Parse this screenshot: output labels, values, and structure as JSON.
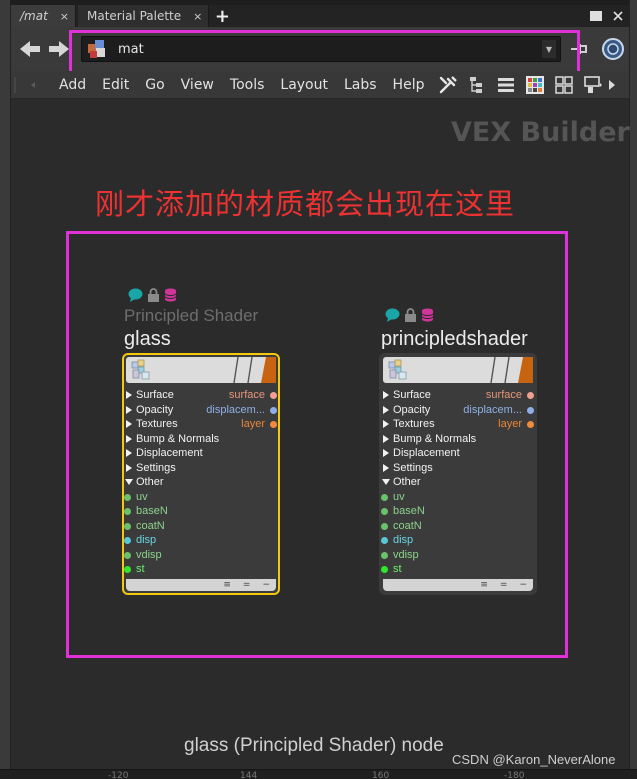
{
  "tabs": [
    {
      "label": "/mat",
      "close": "×",
      "active": true
    },
    {
      "label": "Material Palette",
      "close": "×",
      "active": false
    }
  ],
  "tab_add": "+",
  "path": {
    "value": "mat"
  },
  "menu": [
    "Add",
    "Edit",
    "Go",
    "View",
    "Tools",
    "Layout",
    "Labs",
    "Help"
  ],
  "toolbar_icons": [
    "wrench-icon",
    "tree-view-icon",
    "list-view-icon",
    "color-palette-icon",
    "thumbnail-grid-icon",
    "network-options-icon"
  ],
  "network": {
    "context_title": "VEX Builder",
    "annotation": "刚才添加的材质都会出现在这里",
    "caption": "glass (Principled Shader) node",
    "watermark": "CSDN @Karon_NeverAlone",
    "ruler": [
      "-120",
      "144",
      "160",
      "-180"
    ]
  },
  "nodes": [
    {
      "type_label": "Principled Shader",
      "name": "glass",
      "selected": true,
      "folders": [
        "Surface",
        "Opacity",
        "Textures",
        "Bump & Normals",
        "Displacement",
        "Settings"
      ],
      "open_folder": "Other",
      "inputs": [
        "uv",
        "baseN",
        "coatN",
        "disp",
        "vdisp",
        "st"
      ],
      "outputs": [
        "surface",
        "displacem...",
        "layer"
      ],
      "foot_icons": [
        "≡",
        "=",
        "−"
      ]
    },
    {
      "type_label": "",
      "name": "principledshader",
      "selected": false,
      "folders": [
        "Surface",
        "Opacity",
        "Textures",
        "Bump & Normals",
        "Displacement",
        "Settings"
      ],
      "open_folder": "Other",
      "inputs": [
        "uv",
        "baseN",
        "coatN",
        "disp",
        "vdisp",
        "st"
      ],
      "outputs": [
        "surface",
        "displacem...",
        "layer"
      ],
      "foot_icons": [
        "≡",
        "=",
        "−"
      ]
    }
  ],
  "colors": {
    "highlight": "#e030d8",
    "annotation": "#ec3232",
    "selected_border": "#f2c90f",
    "surface_port": "#f0a090",
    "displacement_port": "#8eaee8",
    "layer_port": "#f08a3c",
    "input_green": "#6cc26c",
    "input_cyan": "#56c8d8",
    "input_lime": "#2ee82e"
  }
}
